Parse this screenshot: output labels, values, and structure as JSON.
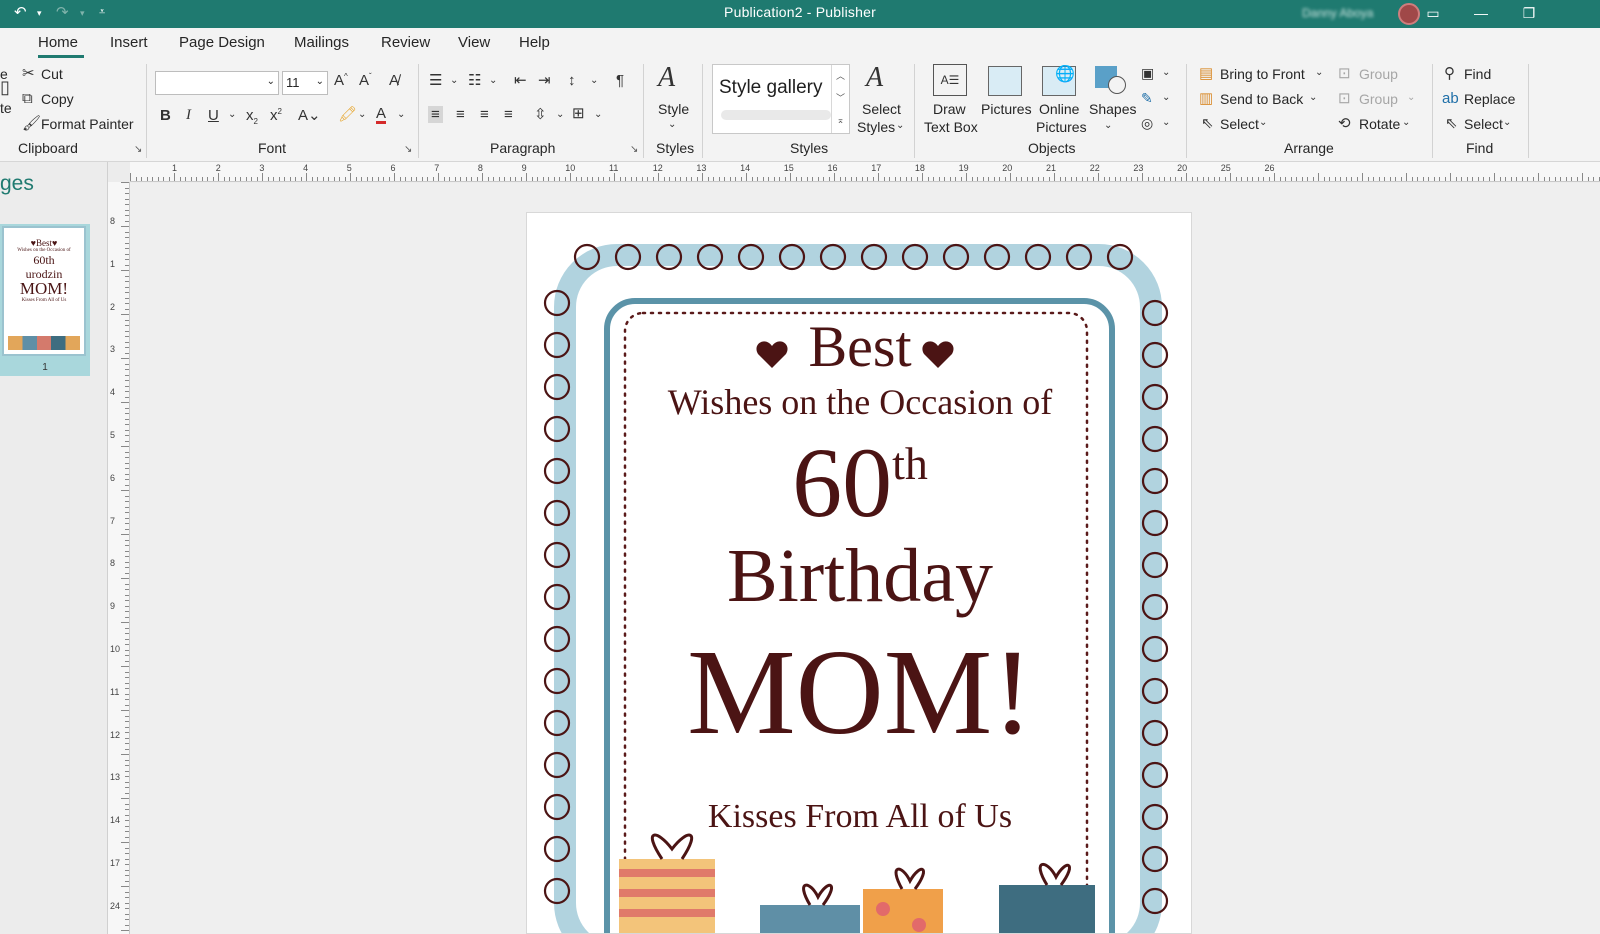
{
  "window": {
    "title": "Publication2 - Publisher",
    "account_name": "Danny Aboya"
  },
  "tabs": [
    "Home",
    "Insert",
    "Page Design",
    "Mailings",
    "Review",
    "View",
    "Help"
  ],
  "clipboard": {
    "cut": "Cut",
    "copy": "Copy",
    "format_painter": "Format Painter",
    "paste_partial": "te",
    "paste_top_partial": "e",
    "group": "Clipboard"
  },
  "font": {
    "name": "",
    "size": "11",
    "group": "Font"
  },
  "paragraph": {
    "group": "Paragraph"
  },
  "styles": {
    "style_label": "Style",
    "gallery_label": "Style gallery",
    "select_styles_1": "Select",
    "select_styles_2": "Styles",
    "group_left": "Styles",
    "group_right": "Styles"
  },
  "objects": {
    "draw_text_box_1": "Draw",
    "draw_text_box_2": "Text Box",
    "pictures": "Pictures",
    "online_pictures_1": "Online",
    "online_pictures_2": "Pictures",
    "shapes": "Shapes",
    "group": "Objects"
  },
  "arrange": {
    "bring_to_front": "Bring to Front",
    "send_to_back": "Send to Back",
    "select": "Select",
    "group_btn": "Group",
    "ungroup_btn": "Group",
    "rotate": "Rotate",
    "group": "Arrange"
  },
  "find": {
    "find": "Find",
    "replace": "Replace",
    "select": "Select",
    "group": "Find"
  },
  "pages_pane": {
    "title_partial": "ges",
    "page_number": "1",
    "thumb_line1": "♥Best♥",
    "thumb_line2": "Wishes on the Occasion of",
    "thumb_line3": "60th",
    "thumb_line4": "urodzin",
    "thumb_line5": "MOM!",
    "thumb_line6": "Kisses From All of Us"
  },
  "card": {
    "best": "Best",
    "wishes": "Wishes on the Occasion of",
    "age": "60",
    "ordinal": "th",
    "birthday": "Birthday",
    "mom": "MOM!",
    "kisses": "Kisses From All of Us"
  },
  "rulers": {
    "horizontal": [
      "1",
      "2",
      "3",
      "4",
      "5",
      "6",
      "7",
      "8",
      "9",
      "10",
      "11",
      "12",
      "13",
      "14",
      "15",
      "16",
      "17",
      "18",
      "19",
      "20",
      "21",
      "22",
      "23",
      "20",
      "25",
      "26"
    ],
    "vertical": [
      "8",
      "1",
      "2",
      "3",
      "4",
      "5",
      "6",
      "7",
      "8",
      "9",
      "10",
      "11",
      "12",
      "13",
      "14",
      "17",
      "24"
    ]
  },
  "colors": {
    "accent": "#1f7a70",
    "card_text": "#4b1414",
    "frame_blue": "#a9cedb",
    "frame_dark": "#5b93a8"
  }
}
